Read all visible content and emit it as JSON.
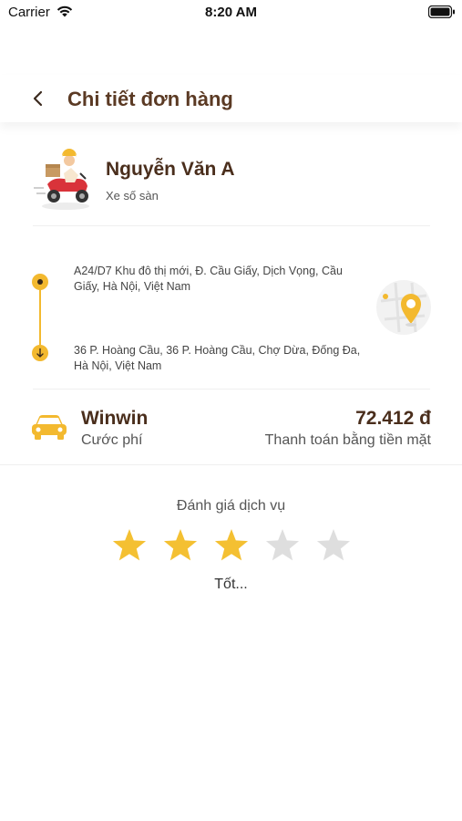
{
  "status_bar": {
    "carrier": "Carrier",
    "time": "8:20 AM"
  },
  "header": {
    "title": "Chi tiết đơn hàng",
    "back_icon": "chevron-left-icon"
  },
  "driver": {
    "name": "Nguyễn Văn A",
    "vehicle": "Xe số sàn",
    "avatar_icon": "delivery-scooter-illustration"
  },
  "route": {
    "pickup_address": "A24/D7 Khu đô thị mới, Đ. Cầu Giấy, Dịch Vọng, Cầu Giấy, Hà Nội, Việt Nam",
    "dropoff_address": "36 P. Hoàng Cầu, 36 P. Hoàng Cầu, Chợ Dừa, Đống Đa, Hà Nội, Việt Nam",
    "map_icon": "map-pin-icon"
  },
  "payment": {
    "service_name": "Winwin",
    "fare_label": "Cước phí",
    "amount": "72.412 đ",
    "method": "Thanh toán bằng tiền mặt",
    "vehicle_icon": "car-icon"
  },
  "rating": {
    "title": "Đánh giá dịch vụ",
    "value": 3,
    "max": 5,
    "text": "Tốt..."
  },
  "colors": {
    "accent": "#F3B92F",
    "title": "#5B3A24",
    "star_active": "#F4C032",
    "star_inactive": "#DEDEDE"
  }
}
